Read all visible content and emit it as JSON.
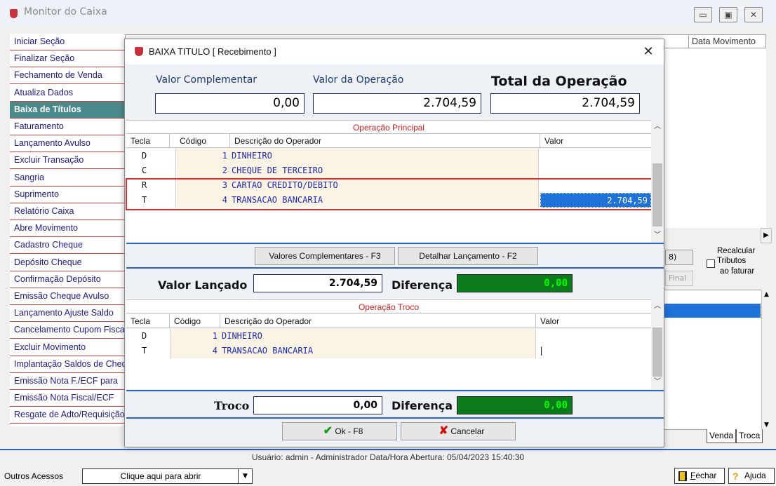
{
  "window": {
    "title": "Monitor do Caixa",
    "btn_min": "▭",
    "btn_max": "▣",
    "btn_close": "✕"
  },
  "left_menu": [
    "Iniciar Seção",
    "Finalizar Seção",
    "Fechamento de Venda",
    "Atualiza Dados",
    "Baixa de Títulos",
    "Faturamento",
    "Lançamento Avulso",
    "Excluir Transação",
    "Sangria",
    "Suprimento",
    "Relatório Caixa",
    "Abre Movimento",
    "Cadastro Cheque",
    "Depósito Cheque",
    "Confirmação Depósito",
    "Emissão Cheque Avulso",
    "Lançamento Ajuste Saldo",
    "Cancelamento Cupom Fiscal",
    "Excluir Movimento",
    "Implantação Saldos de Cheque",
    "Emissão Nota F./ECF para",
    "Emissão Nota Fiscal/ECF",
    "Resgate de Adto/Requisição"
  ],
  "background": {
    "col_date": "Data Movimento",
    "btn_small1": "8)",
    "btn_small2": "Final",
    "recalc_lines": [
      "Recalcular",
      "Tributos",
      "ao faturar"
    ],
    "tab_venda": "Venda",
    "tab_troca": "Troca"
  },
  "dialog": {
    "title": "BAIXA TITULO [ Recebimento ]",
    "close": "✕",
    "valor_complementar_label": "Valor Complementar",
    "valor_complementar": "0,00",
    "valor_operacao_label": "Valor da Operação",
    "valor_operacao": "2.704,59",
    "total_operacao_label": "Total da Operação",
    "total_operacao": "2.704,59",
    "principal": {
      "title": "Operação Principal",
      "headers": [
        "Tecla",
        "Código",
        "Descrição do Operador",
        "Valor"
      ],
      "rows": [
        {
          "tecla": "D",
          "codigo": "1",
          "descricao": "DINHEIRO",
          "valor": ""
        },
        {
          "tecla": "C",
          "codigo": "2",
          "descricao": "CHEQUE DE TERCEIRO",
          "valor": ""
        },
        {
          "tecla": "R",
          "codigo": "3",
          "descricao": "CARTAO CREDITO/DEBITO",
          "valor": ""
        },
        {
          "tecla": "T",
          "codigo": "4",
          "descricao": "TRANSACAO BANCARIA",
          "valor": "2.704,59"
        }
      ]
    },
    "btn_valores_complementares": "Valores Complementares - F3",
    "btn_detalhar": "Detalhar Lançamento - F2",
    "valor_lancado_label": "Valor Lançado",
    "valor_lancado": "2.704,59",
    "diferenca_label": "Diferença",
    "diferenca": "0,00",
    "troco_grid": {
      "title": "Operação Troco",
      "headers": [
        "Tecla",
        "Código",
        "Descrição do Operador",
        "Valor"
      ],
      "rows": [
        {
          "tecla": "D",
          "codigo": "1",
          "descricao": "DINHEIRO",
          "valor": ""
        },
        {
          "tecla": "T",
          "codigo": "4",
          "descricao": "TRANSACAO BANCARIA",
          "valor": "|"
        }
      ]
    },
    "troco_label": "Troco",
    "troco": "0,00",
    "diferenca2_label": "Diferença",
    "diferenca2": "0,00",
    "btn_ok": "Ok - F8",
    "btn_cancelar": "Cancelar"
  },
  "status": {
    "text": "Usuário: admin - Administrador Data/Hora Abertura: 05/04/2023 15:40:30"
  },
  "bottom": {
    "outros_label": "Outros Acessos",
    "outros_value": "Clique aqui para abrir",
    "fechar_u": "F",
    "fechar_rest": "echar",
    "ajuda": "Ajuda"
  },
  "colors": {
    "accent": "#2b62c8",
    "selection": "#1e72d8",
    "menu_active": "#4a8a8a",
    "diff_bg": "#0a7a1a",
    "highlight_border": "#e03030"
  }
}
